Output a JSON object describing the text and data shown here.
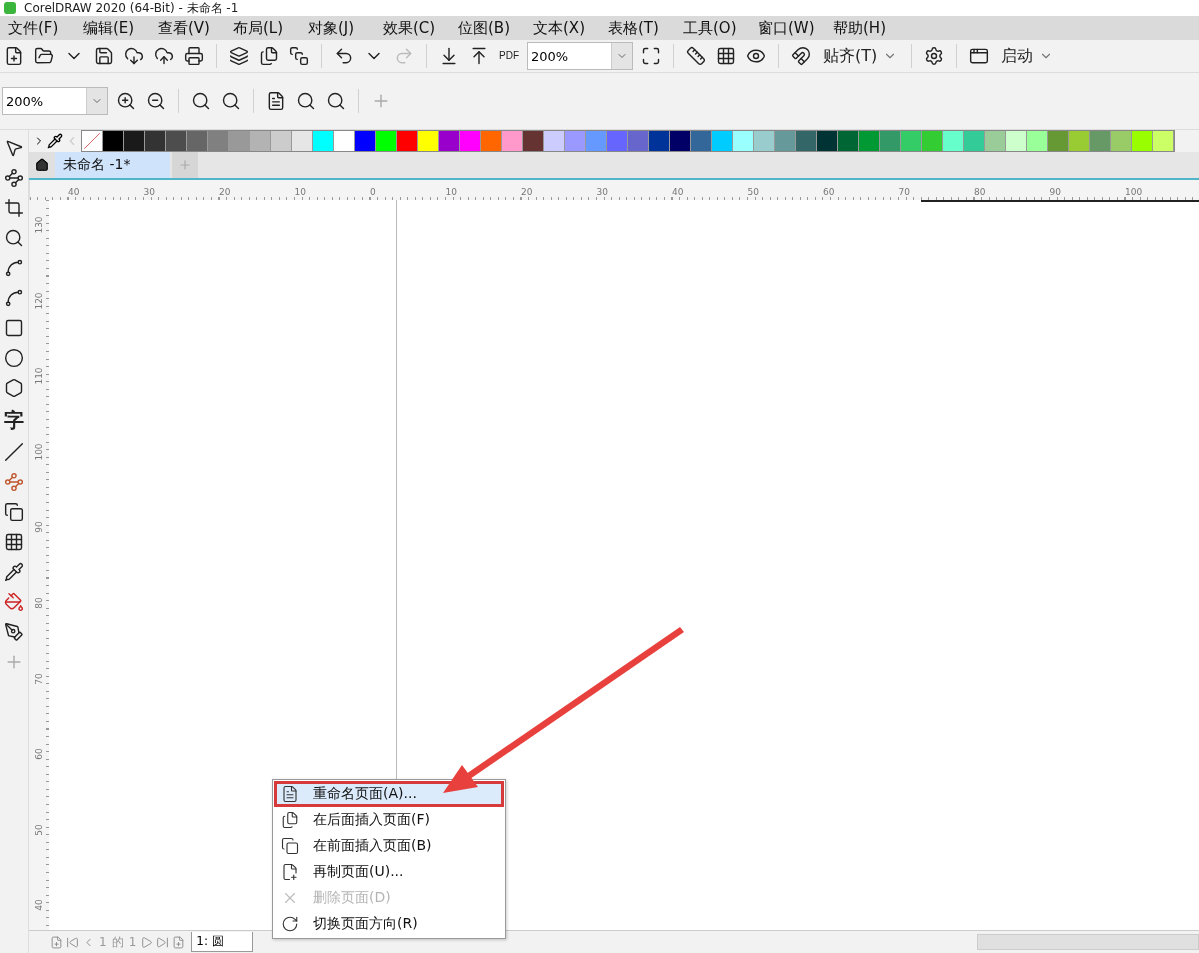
{
  "window": {
    "title": "CorelDRAW 2020 (64-Bit) - 未命名 -1"
  },
  "menu": [
    "文件(F)",
    "编辑(E)",
    "查看(V)",
    "布局(L)",
    "对象(J)",
    "效果(C)",
    "位图(B)",
    "文本(X)",
    "表格(T)",
    "工具(O)",
    "窗口(W)",
    "帮助(H)"
  ],
  "toolbar": {
    "pdf": "PDF",
    "zoom": "200%",
    "snap": "贴齐(T)",
    "launch": "启动"
  },
  "zoom_toolbar": {
    "zoom": "200%"
  },
  "toolbox": {
    "text_glyph": "字"
  },
  "palette": [
    {
      "color": "#000000"
    },
    {
      "color": "#1a1a1a"
    },
    {
      "color": "#333333"
    },
    {
      "color": "#4d4d4d"
    },
    {
      "color": "#666666"
    },
    {
      "color": "#808080"
    },
    {
      "color": "#999999"
    },
    {
      "color": "#b3b3b3"
    },
    {
      "color": "#cccccc"
    },
    {
      "color": "#e6e6e6"
    },
    {
      "color": "#00ffff"
    },
    {
      "color": "#ffffff"
    },
    {
      "color": "#0000ff"
    },
    {
      "color": "#00ff00"
    },
    {
      "color": "#ff0000"
    },
    {
      "color": "#ffff00"
    },
    {
      "color": "#9900cc"
    },
    {
      "color": "#ff00ff"
    },
    {
      "color": "#ff6600"
    },
    {
      "color": "#ff99cc"
    },
    {
      "color": "#663333"
    },
    {
      "color": "#ccccff"
    },
    {
      "color": "#9999ff"
    },
    {
      "color": "#6699ff"
    },
    {
      "color": "#6666ff"
    },
    {
      "color": "#6666cc"
    },
    {
      "color": "#003399"
    },
    {
      "color": "#000066"
    },
    {
      "color": "#336699"
    },
    {
      "color": "#00ccff"
    },
    {
      "color": "#99ffff"
    },
    {
      "color": "#99cccc"
    },
    {
      "color": "#669999"
    },
    {
      "color": "#336666"
    },
    {
      "color": "#003333"
    },
    {
      "color": "#006633"
    },
    {
      "color": "#009933"
    },
    {
      "color": "#339966"
    },
    {
      "color": "#33cc66"
    },
    {
      "color": "#33cc33"
    },
    {
      "color": "#66ffcc"
    },
    {
      "color": "#33cc99"
    },
    {
      "color": "#99cc99"
    },
    {
      "color": "#ccffcc"
    },
    {
      "color": "#99ff99"
    },
    {
      "color": "#669933"
    },
    {
      "color": "#99cc33"
    },
    {
      "color": "#669966"
    },
    {
      "color": "#99cc66"
    },
    {
      "color": "#99ff00"
    },
    {
      "color": "#ccff66"
    }
  ],
  "doc_tabs": [
    {
      "label": "未命名 -1*",
      "selected": true
    }
  ],
  "ruler_h": [
    "40",
    "30",
    "20",
    "10",
    "0",
    "10",
    "20",
    "30",
    "40",
    "50",
    "60",
    "70",
    "80",
    "90",
    "100"
  ],
  "ruler_v": [
    "130",
    "120",
    "110",
    "100",
    "90",
    "80",
    "70",
    "60",
    "50",
    "40"
  ],
  "context_menu": [
    {
      "kind": "rename",
      "label": "重命名页面(A)...",
      "selected": true,
      "disabled": false
    },
    {
      "kind": "insert_after",
      "label": "在后面插入页面(F)",
      "selected": false,
      "disabled": false
    },
    {
      "kind": "insert_before",
      "label": "在前面插入页面(B)",
      "selected": false,
      "disabled": false
    },
    {
      "kind": "duplicate",
      "label": "再制页面(U)...",
      "selected": false,
      "disabled": false
    },
    {
      "kind": "delete",
      "label": "删除页面(D)",
      "selected": false,
      "disabled": true
    },
    {
      "kind": "orientation",
      "label": "切换页面方向(R)",
      "selected": false,
      "disabled": false
    }
  ],
  "page_nav": {
    "current": "1",
    "of": "的",
    "total": "1"
  },
  "page_tabs": [
    {
      "label": "1: 圆",
      "selected": true
    }
  ]
}
